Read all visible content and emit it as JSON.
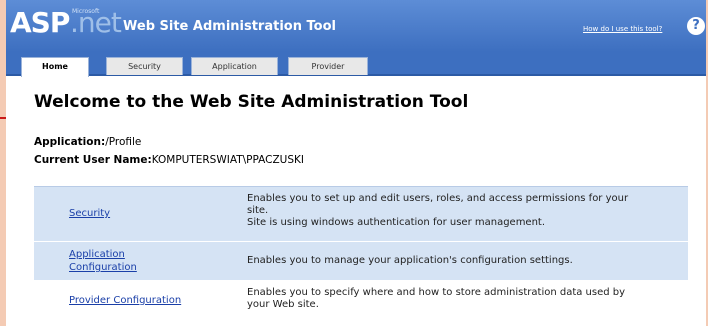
{
  "header": {
    "logo_asp": "ASP",
    "logo_net": ".net",
    "logo_ms": "Microsoft",
    "title": "Web Site Administration Tool",
    "help_link": "How do I use this tool?",
    "help_icon_char": "?"
  },
  "tabs": [
    {
      "label": "Home",
      "active": true
    },
    {
      "label": "Security",
      "active": false
    },
    {
      "label": "Application",
      "active": false
    },
    {
      "label": "Provider",
      "active": false
    }
  ],
  "main": {
    "title": "Welcome to the Web Site Administration Tool",
    "application_label": "Application:",
    "application_value": "/Profile",
    "user_label": "Current User Name:",
    "user_value": "KOMPUTERSWIAT\\PPACZUSKI"
  },
  "table": {
    "rows": [
      {
        "link": "Security",
        "desc_lines": [
          "Enables you to set up and edit users, roles, and access permissions for your",
          "site.",
          "Site is using windows authentication for user management."
        ]
      },
      {
        "link_lines": [
          "Application",
          "Configuration"
        ],
        "desc_lines": [
          "Enables you to manage your application's configuration settings."
        ]
      },
      {
        "link": "Provider Configuration",
        "desc_lines": [
          "Enables you to specify where and how to store administration data used by",
          "your Web site."
        ]
      }
    ]
  },
  "colors": {
    "header_blue": "#3d6fc0",
    "row_shade": "#d5e3f4",
    "link_blue": "#1a3fa8",
    "arrow_red": "#c91a1a"
  }
}
